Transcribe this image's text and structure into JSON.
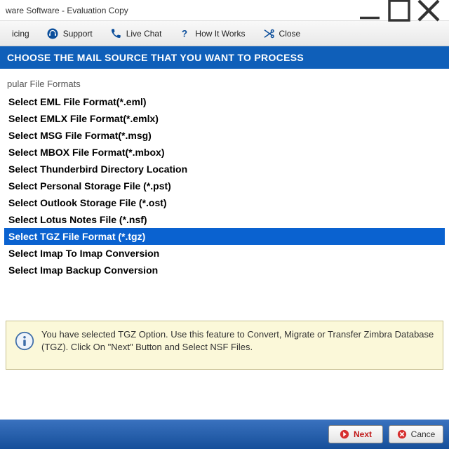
{
  "window": {
    "title": "ware Software - Evaluation Copy"
  },
  "toolbar": {
    "pricing": "icing",
    "support": "Support",
    "livechat": "Live Chat",
    "how": "How It Works",
    "close": "Close"
  },
  "header": "CHOOSE THE MAIL SOURCE THAT YOU WANT TO PROCESS",
  "section_title": "pular File Formats",
  "formats": [
    "Select EML File Format(*.eml)",
    "Select EMLX File Format(*.emlx)",
    "Select MSG File Format(*.msg)",
    "Select MBOX File Format(*.mbox)",
    "Select Thunderbird Directory Location",
    "Select Personal Storage File (*.pst)",
    "Select Outlook Storage File (*.ost)",
    "Select Lotus Notes File (*.nsf)",
    "Select TGZ File Format (*.tgz)",
    "Select Imap To Imap Conversion",
    "Select Imap Backup Conversion"
  ],
  "selected_index": 8,
  "info": "You have selected TGZ Option. Use this feature to Convert, Migrate or Transfer Zimbra Database (TGZ). Click On \"Next\" Button and Select NSF Files.",
  "footer": {
    "next": "Next",
    "cancel": "Cance"
  }
}
